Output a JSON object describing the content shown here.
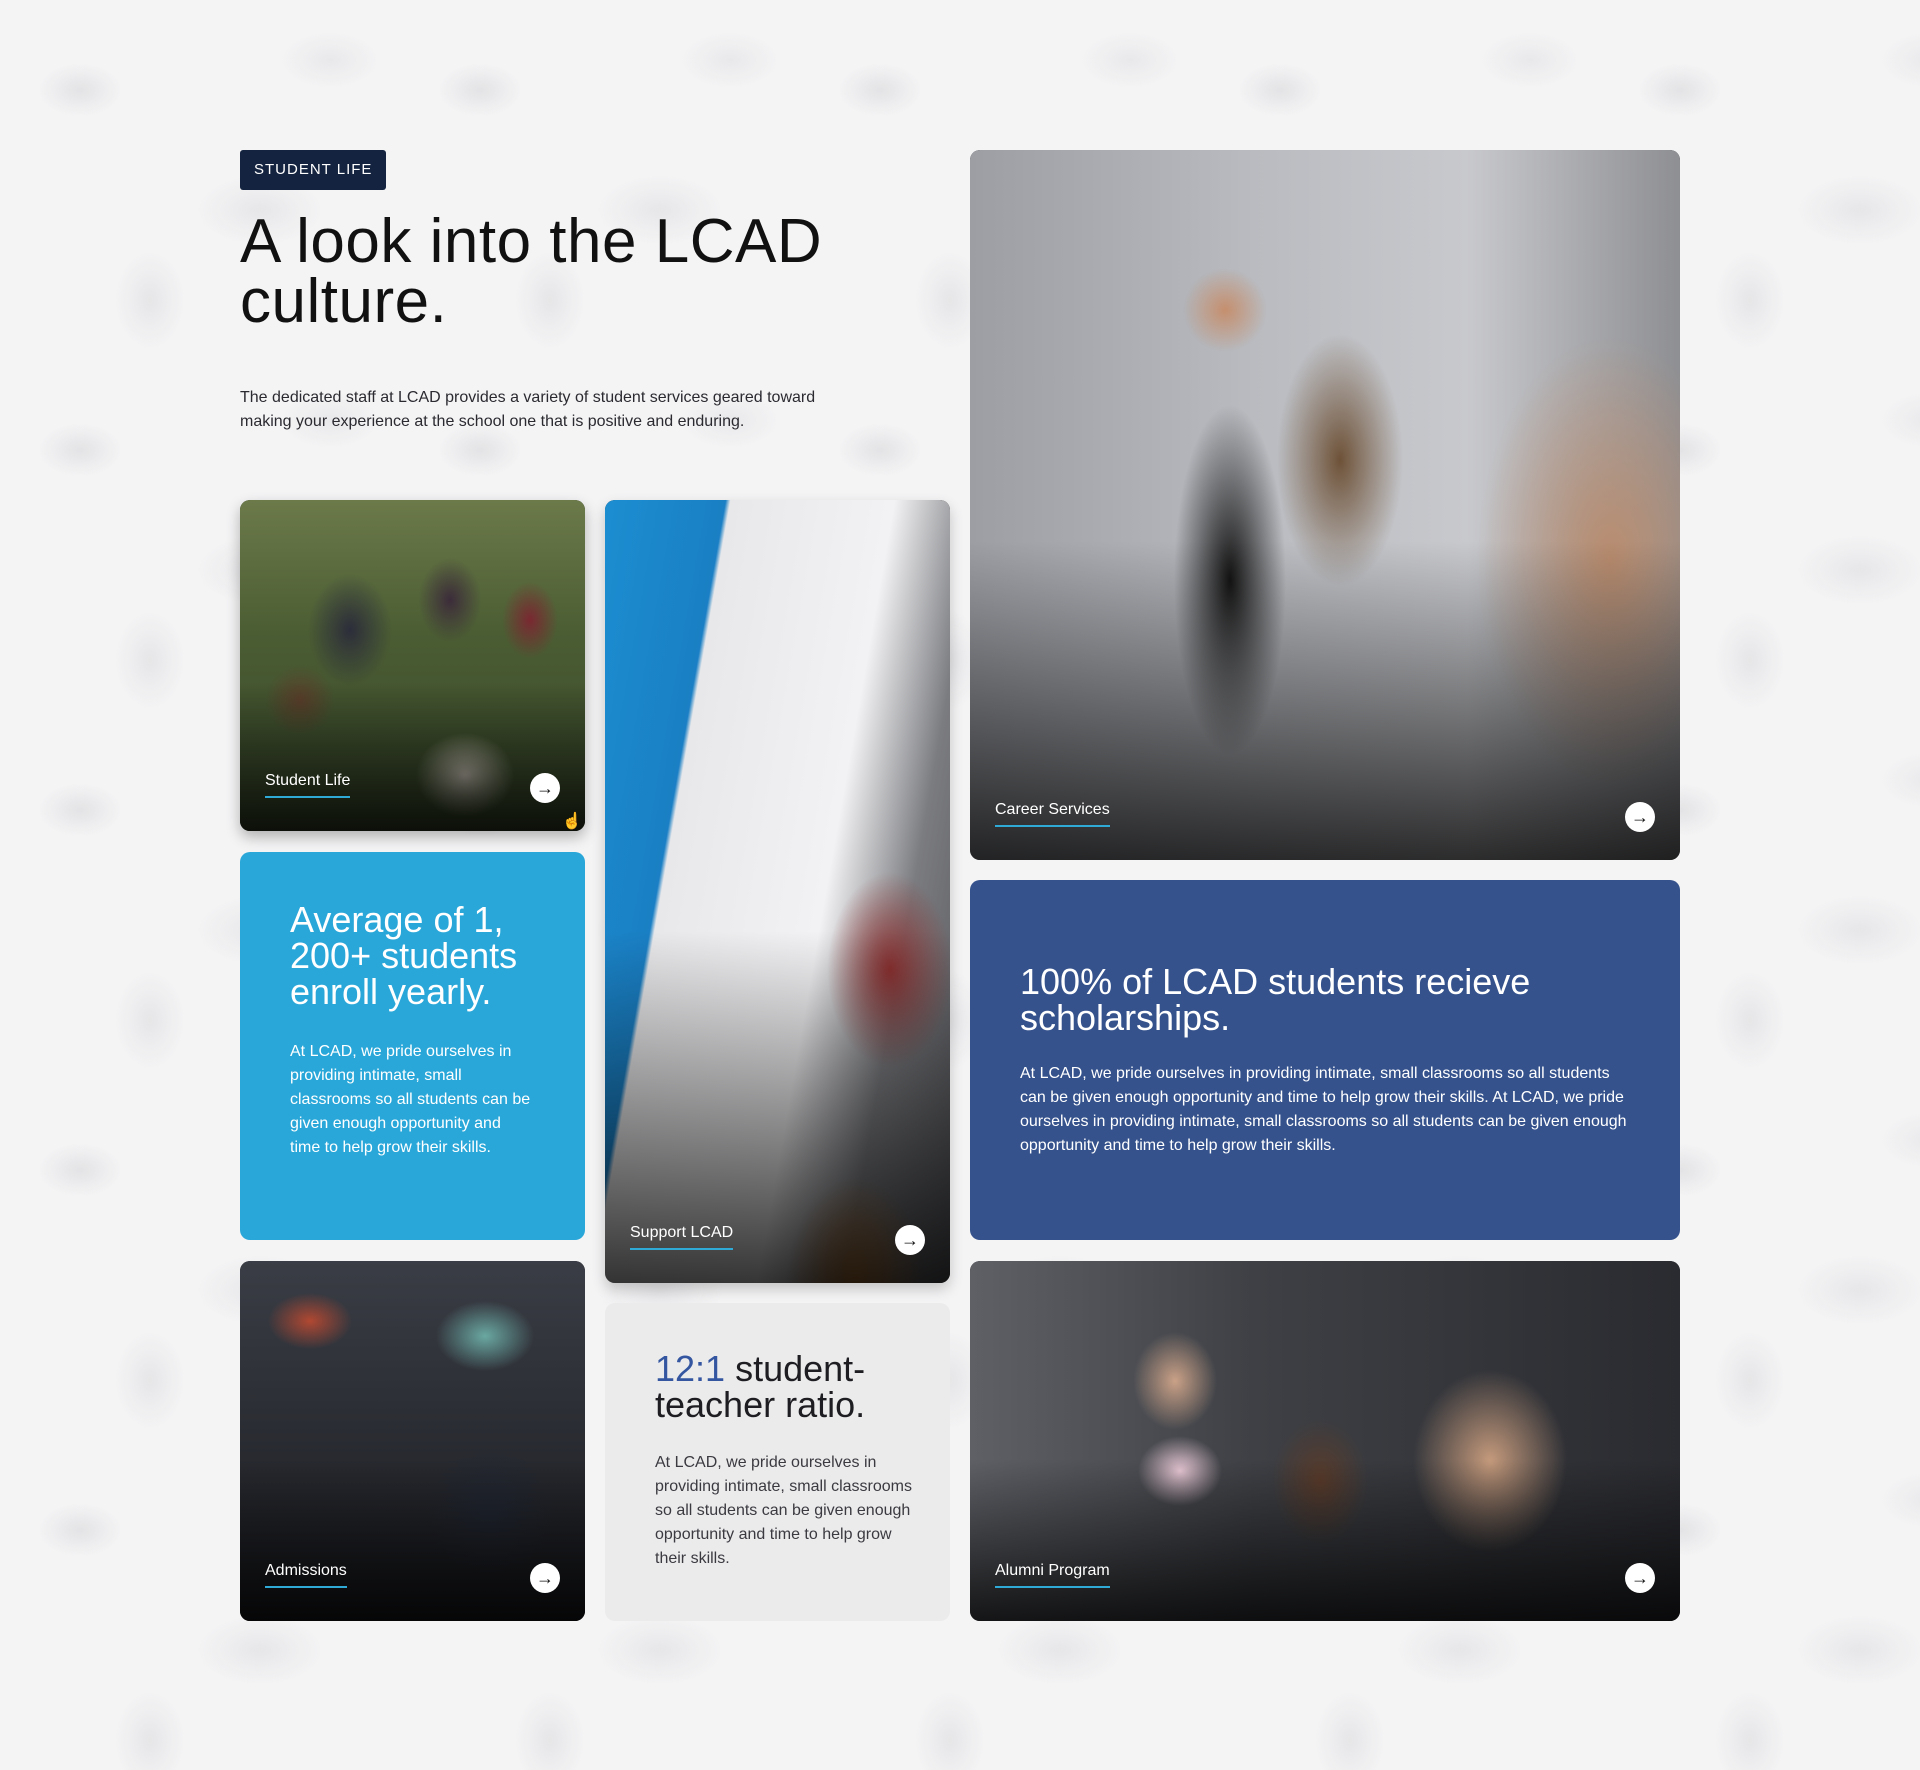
{
  "header": {
    "badge": "STUDENT LIFE",
    "title": "A look into the LCAD culture.",
    "intro": "The dedicated staff at LCAD provides a variety of student services geared toward making your experience at the school one that is positive and enduring."
  },
  "tiles": {
    "student_life": {
      "label": "Student Life",
      "arrow": "→",
      "icon": "arrow-right-icon"
    },
    "support": {
      "label": "Support LCAD",
      "arrow": "→",
      "icon": "arrow-right-icon"
    },
    "career": {
      "label": "Career Services",
      "arrow": "→",
      "icon": "arrow-right-icon"
    },
    "admissions": {
      "label": "Admissions",
      "arrow": "→",
      "icon": "arrow-right-icon"
    },
    "alumni": {
      "label": "Alumni Program",
      "arrow": "→",
      "icon": "arrow-right-icon"
    }
  },
  "stats": {
    "enroll": {
      "headline": "Average of 1, 200+ students enroll yearly.",
      "body": "At LCAD, we pride ourselves in providing intimate, small classrooms so all students can be given enough opportunity and time to help grow their skills."
    },
    "scholarships": {
      "headline": "100% of LCAD students recieve scholarships.",
      "body": "At LCAD, we pride ourselves in providing intimate, small classrooms so all students can be given enough opportunity and time to help grow their skills. At LCAD, we pride ourselves in providing intimate, small classrooms so all students can be given enough opportunity and time to help grow their skills."
    },
    "ratio": {
      "accent": "12:1",
      "headline_rest": " student-teacher ratio.",
      "body": "At LCAD, we pride ourselves in providing intimate, small classrooms so all students can be given enough opportunity and time to help grow their skills."
    }
  },
  "colors": {
    "badge_bg": "#14233f",
    "enroll_bg": "#2aa7d9",
    "scholar_bg": "#35528c",
    "ratio_bg": "#ebebec",
    "ratio_accent": "#3456a0",
    "label_underline": "#2fa9d6"
  }
}
